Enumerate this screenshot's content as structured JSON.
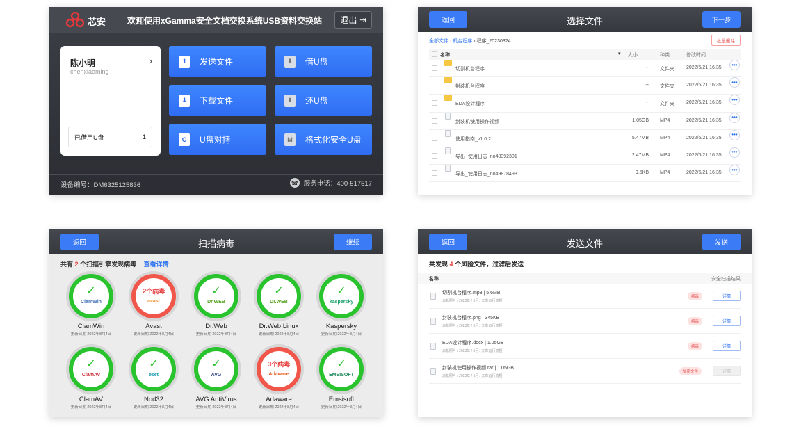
{
  "home": {
    "brand": "芯安",
    "welcome": "欢迎使用xGamma安全文档交换系统USB资料交换站",
    "logout": "退出",
    "user": {
      "name": "陈小明",
      "id": "chenxiaoming",
      "arrow": "›"
    },
    "borrowed": {
      "label": "已借用U盘",
      "count": "1"
    },
    "tiles": [
      {
        "label": "发送文件",
        "icon": "upload-icon",
        "glyph": "⬆"
      },
      {
        "label": "借U盘",
        "icon": "usb-icon",
        "glyph": "⬇"
      },
      {
        "label": "下载文件",
        "icon": "download-icon",
        "glyph": "⬇"
      },
      {
        "label": "还U盘",
        "icon": "usb-return-icon",
        "glyph": "⬆"
      },
      {
        "label": "U盘对拷",
        "icon": "copy-icon",
        "glyph": "C"
      },
      {
        "label": "格式化安全U盘",
        "icon": "format-icon",
        "glyph": "M"
      }
    ],
    "device": "设备编号：DM6325125836",
    "phone": "服务电话：400-517517"
  },
  "select": {
    "back": "返回",
    "title": "选择文件",
    "next": "下一步",
    "breadcrumb": {
      "root": "全部文件",
      "sep": "›",
      "mid": "机台程序",
      "current": "程序_20230324"
    },
    "batch_delete": "批量删除",
    "columns": {
      "name": "名称",
      "size": "大小",
      "type": "种类",
      "modified": "修改时间"
    },
    "rows": [
      {
        "name": "切割机台程序",
        "size": "--",
        "type": "文件夹",
        "modified": "2022/6/21 16:35",
        "kind": "folder"
      },
      {
        "name": "封装机台程序",
        "size": "--",
        "type": "文件夹",
        "modified": "2022/6/21 16:35",
        "kind": "folder"
      },
      {
        "name": "EDA设计程序",
        "size": "--",
        "type": "文件夹",
        "modified": "2022/6/21 16:35",
        "kind": "folder"
      },
      {
        "name": "封装机使用操作视频",
        "size": "1.05GB",
        "type": "MP4",
        "modified": "2022/6/21 16:35",
        "kind": "file"
      },
      {
        "name": "使用指南_v1.0.2",
        "size": "5.47MB",
        "type": "MP4",
        "modified": "2022/6/21 16:35",
        "kind": "file"
      },
      {
        "name": "导出_使用日志_no48392301",
        "size": "2.47MB",
        "type": "MP4",
        "modified": "2022/6/21 16:35",
        "kind": "file"
      },
      {
        "name": "导出_使用日志_no49878493",
        "size": "9.5KB",
        "type": "MP4",
        "modified": "2022/6/21 16:35",
        "kind": "file"
      }
    ]
  },
  "scan": {
    "back": "返回",
    "title": "扫描病毒",
    "continue": "继续",
    "summary": {
      "prefix": "共有",
      "count": "2",
      "suffix": "个扫描引擎发现病毒",
      "link": "查看详情"
    },
    "engines": [
      {
        "name": "ClamWin",
        "date": "更新日期 2022年8月4日",
        "ok": true,
        "logo": "ClamWin",
        "logo_color": "#3d6fb6"
      },
      {
        "name": "Avast",
        "date": "更新日期 2022年8月4日",
        "ok": false,
        "virus_num": "2",
        "virus_text": "个病毒",
        "logo": "avast",
        "logo_color": "#f08a24"
      },
      {
        "name": "Dr.Web",
        "date": "更新日期 2022年8月4日",
        "ok": true,
        "logo": "Dr.WEB",
        "logo_color": "#5aa626"
      },
      {
        "name": "Dr.Web Linux",
        "date": "更新日期 2022年8月4日",
        "ok": true,
        "logo": "Dr.WEB",
        "logo_color": "#5aa626"
      },
      {
        "name": "Kaspersky",
        "date": "更新日期 2022年8月4日",
        "ok": true,
        "logo": "kaspersky",
        "logo_color": "#159e67"
      },
      {
        "name": "ClamAV",
        "date": "更新日期 2022年8月4日",
        "ok": true,
        "logo": "ClamAV",
        "logo_color": "#c8232c"
      },
      {
        "name": "Nod32",
        "date": "更新日期 2022年8月4日",
        "ok": true,
        "logo": "eset",
        "logo_color": "#1a9bb0"
      },
      {
        "name": "AVG AntiVirus",
        "date": "更新日期 2022年8月4日",
        "ok": true,
        "logo": "AVG",
        "logo_color": "#2b3f86"
      },
      {
        "name": "Adaware",
        "date": "更新日期 2022年8月4日",
        "ok": false,
        "virus_num": "3",
        "virus_text": "个病毒",
        "logo": "Adaware",
        "logo_color": "#e85b1c"
      },
      {
        "name": "Emsisoft",
        "date": "更新日期 2022年8月4日",
        "ok": true,
        "logo": "EMSISOFT",
        "logo_color": "#1f8a5b"
      }
    ]
  },
  "send": {
    "back": "返回",
    "title": "发送文件",
    "send": "发送",
    "summary": {
      "prefix": "共发现",
      "count": "4",
      "suffix": "个风险文件，过滤后发送"
    },
    "columns": {
      "name": "名称",
      "result": "安全扫描结果"
    },
    "rows": [
      {
        "name": "切割机台程序.mp3  |  5.6MB",
        "path": "派松照片 / 2023年 / 5月 / 天车运行流程",
        "tag": "病毒",
        "detail": "详情",
        "disabled": false
      },
      {
        "name": "封装机台程序.png  |  345KB",
        "path": "派松照片 / 2023年 / 5月 / 天车运行流程",
        "tag": "病毒",
        "detail": "详情",
        "disabled": false
      },
      {
        "name": "EDA设计程序.docx  |  1.05GB",
        "path": "派松照片 / 2023年 / 5月 / 天车运行流程",
        "tag": "病毒",
        "detail": "详情",
        "disabled": false
      },
      {
        "name": "封装机使用操作视频.rar  |  1.05GB",
        "path": "派松照片 / 2023年 / 5月 / 天车运行流程",
        "tag": "加密文件",
        "detail": "详情",
        "disabled": true
      }
    ]
  }
}
